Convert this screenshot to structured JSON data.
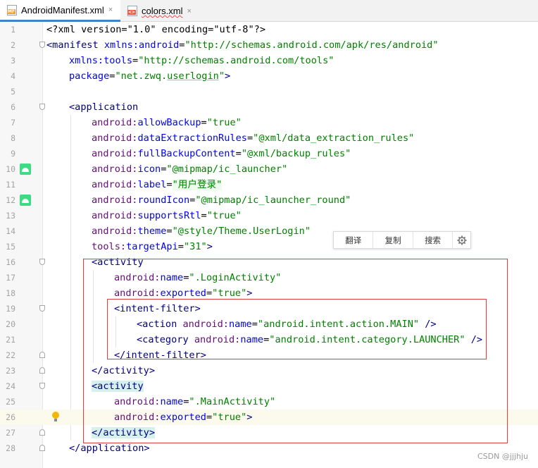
{
  "tabs": [
    {
      "label": "AndroidManifest.xml",
      "icon": "manifest-file-icon",
      "badge": "MF",
      "active": true
    },
    {
      "label": "colors.xml",
      "icon": "xml-file-icon",
      "badge": "<>",
      "active": false
    }
  ],
  "tab_close_glyph": "×",
  "editor": {
    "current_line": 26,
    "lines": [
      {
        "n": "1"
      },
      {
        "n": "2"
      },
      {
        "n": "3"
      },
      {
        "n": "4"
      },
      {
        "n": "5"
      },
      {
        "n": "6"
      },
      {
        "n": "7"
      },
      {
        "n": "8"
      },
      {
        "n": "9"
      },
      {
        "n": "10"
      },
      {
        "n": "11"
      },
      {
        "n": "12"
      },
      {
        "n": "13"
      },
      {
        "n": "14"
      },
      {
        "n": "15"
      },
      {
        "n": "16"
      },
      {
        "n": "17"
      },
      {
        "n": "18"
      },
      {
        "n": "19"
      },
      {
        "n": "20"
      },
      {
        "n": "21"
      },
      {
        "n": "22"
      },
      {
        "n": "23"
      },
      {
        "n": "24"
      },
      {
        "n": "25"
      },
      {
        "n": "26"
      },
      {
        "n": "27"
      },
      {
        "n": "28"
      }
    ],
    "text": {
      "l1_decl": "<?xml version=\"1.0\" encoding=\"utf-8\"?>",
      "l2_open": "<manifest",
      "l2_ns": "xmlns:android",
      "l2_eq": "=",
      "l2_val": "\"http://schemas.android.com/apk/res/android\"",
      "l3_ns": "xmlns:tools",
      "l3_val": "\"http://schemas.android.com/tools\"",
      "l4_attr": "package",
      "l4_val_q1": "\"net.zwq.",
      "l4_val_ul": "userlogin",
      "l4_val_q2": "\"",
      "l4_close": ">",
      "l6": "<application",
      "l7_pfx": "android:",
      "l7_attr": "allowBackup",
      "l7_val": "\"true\"",
      "l8_attr": "dataExtractionRules",
      "l8_val": "\"@xml/data_extraction_rules\"",
      "l9_attr": "fullBackupContent",
      "l9_val": "\"@xml/backup_rules\"",
      "l10_attr": "icon",
      "l10_val": "\"@mipmap/ic_launcher\"",
      "l11_attr": "label",
      "l11_val": "\"用户登录\"",
      "l12_attr": "roundIcon",
      "l12_val": "\"@mipmap/ic_launcher_round\"",
      "l13_attr": "supportsRtl",
      "l13_val": "\"true\"",
      "l14_attr": "theme",
      "l14_val": "\"@style/Theme.UserLogin\"",
      "l15_pfx": "tools:",
      "l15_attr": "targetApi",
      "l15_val": "\"31\"",
      "l15_close": ">",
      "l16": "<activity",
      "l17_attr": "name",
      "l17_val": "\".LoginActivity\"",
      "l18_attr": "exported",
      "l18_val": "\"true\"",
      "l18_close": ">",
      "l19": "<intent-filter>",
      "l20_tag": "<action",
      "l20_attr": "name",
      "l20_val": "\"android.intent.action.MAIN\"",
      "l20_close": " />",
      "l21_tag": "<category",
      "l21_attr": "name",
      "l21_val": "\"android.intent.category.LAUNCHER\"",
      "l21_close": " />",
      "l22": "</intent-filter>",
      "l23": "</activity>",
      "l24": "<activity",
      "l25_attr": "name",
      "l25_val": "\".MainActivity\"",
      "l26_attr": "exported",
      "l26_val": "\"true\"",
      "l26_close": ">",
      "l27": "</activity>",
      "l28": "</application>"
    }
  },
  "popup_toolbar": {
    "translate": "翻译",
    "copy": "复制",
    "search": "搜索",
    "settings_icon": "gear-icon"
  },
  "watermark": "CSDN @jjjhju",
  "colors": {
    "tag": "#000080",
    "namespace": "#660e7a",
    "attribute": "#0000ff",
    "value": "#008000",
    "annotation_box": "#d94040",
    "tab_active_underline": "#4083c9"
  }
}
